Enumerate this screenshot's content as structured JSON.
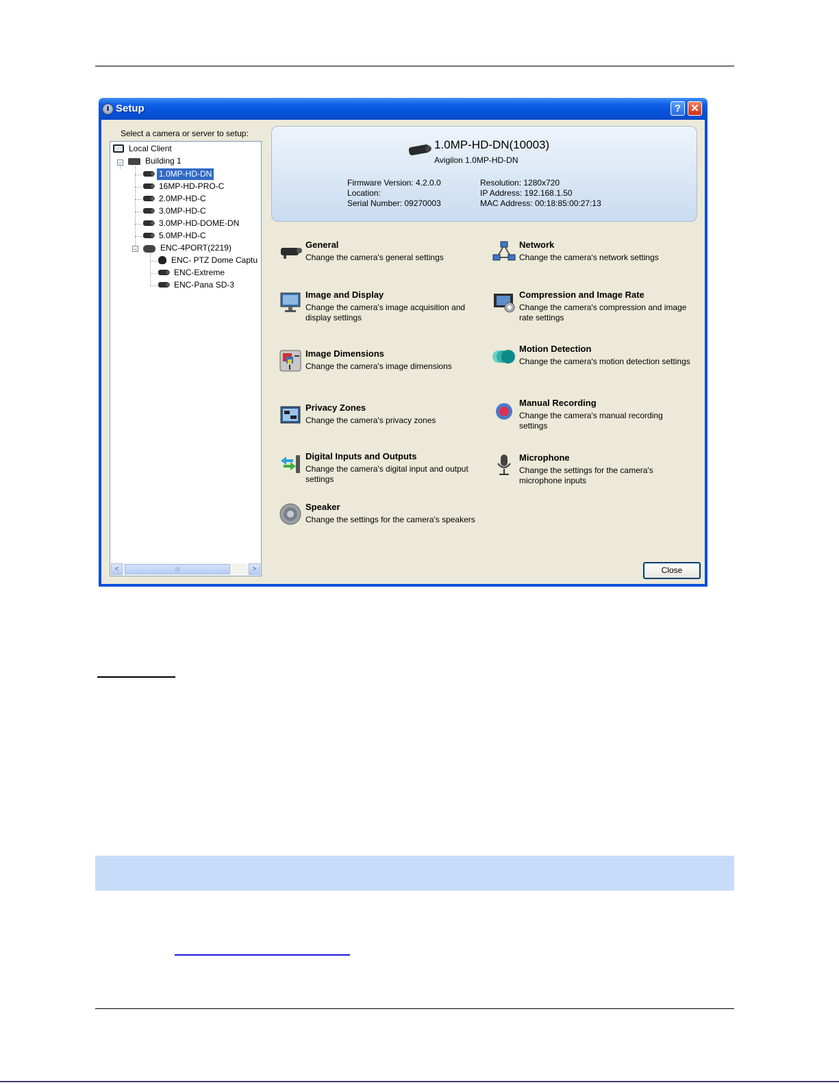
{
  "window": {
    "title": "Setup",
    "help_btn": "?",
    "close_btn": "✕"
  },
  "tree": {
    "label": "Select a camera or server to setup:",
    "nodes": [
      {
        "label": "Local Client"
      },
      {
        "label": "Building 1"
      },
      {
        "label": "1.0MP-HD-DN",
        "selected": true
      },
      {
        "label": "16MP-HD-PRO-C"
      },
      {
        "label": "2.0MP-HD-C"
      },
      {
        "label": "3.0MP-HD-C"
      },
      {
        "label": "3.0MP-HD-DOME-DN"
      },
      {
        "label": "5.0MP-HD-C"
      },
      {
        "label": "ENC-4PORT(2219)"
      },
      {
        "label": "ENC- PTZ Dome Captu"
      },
      {
        "label": "ENC-Extreme"
      },
      {
        "label": "ENC-Pana SD-3"
      }
    ],
    "scroll_left": "<",
    "scroll_right": ">",
    "scroll_thumb": "|||"
  },
  "header": {
    "title": "1.0MP-HD-DN(10003)",
    "subtitle": "Avigilon 1.0MP-HD-DN",
    "firmware": "Firmware Version: 4.2.0.0",
    "location": "Location:",
    "serial": "Serial Number: 09270003",
    "resolution": "Resolution: 1280x720",
    "ip": "IP Address: 192.168.1.50",
    "mac": "MAC Address: 00:18:85:00:27:13"
  },
  "items": {
    "general": {
      "title": "General",
      "desc": "Change the camera's general settings"
    },
    "network": {
      "title": "Network",
      "desc": "Change the camera's network settings"
    },
    "image_display": {
      "title": "Image and Display",
      "desc": "Change the camera's image acquisition and display settings"
    },
    "compression": {
      "title": "Compression and Image Rate",
      "desc": "Change the camera's compression and image rate settings"
    },
    "image_dimensions": {
      "title": "Image Dimensions",
      "desc": "Change the camera's image dimensions"
    },
    "motion": {
      "title": "Motion Detection",
      "desc": "Change the camera's motion detection settings"
    },
    "privacy": {
      "title": "Privacy Zones",
      "desc": "Change the camera's privacy zones"
    },
    "manual_recording": {
      "title": "Manual Recording",
      "desc": "Change the camera's manual recording settings"
    },
    "digital_io": {
      "title": "Digital Inputs and Outputs",
      "desc": "Change the camera's digital input and output settings"
    },
    "microphone": {
      "title": "Microphone",
      "desc": "Change the settings for the camera's microphone inputs"
    },
    "speaker": {
      "title": "Speaker",
      "desc": "Change the settings for the camera's speakers"
    }
  },
  "buttons": {
    "close": "Close"
  }
}
